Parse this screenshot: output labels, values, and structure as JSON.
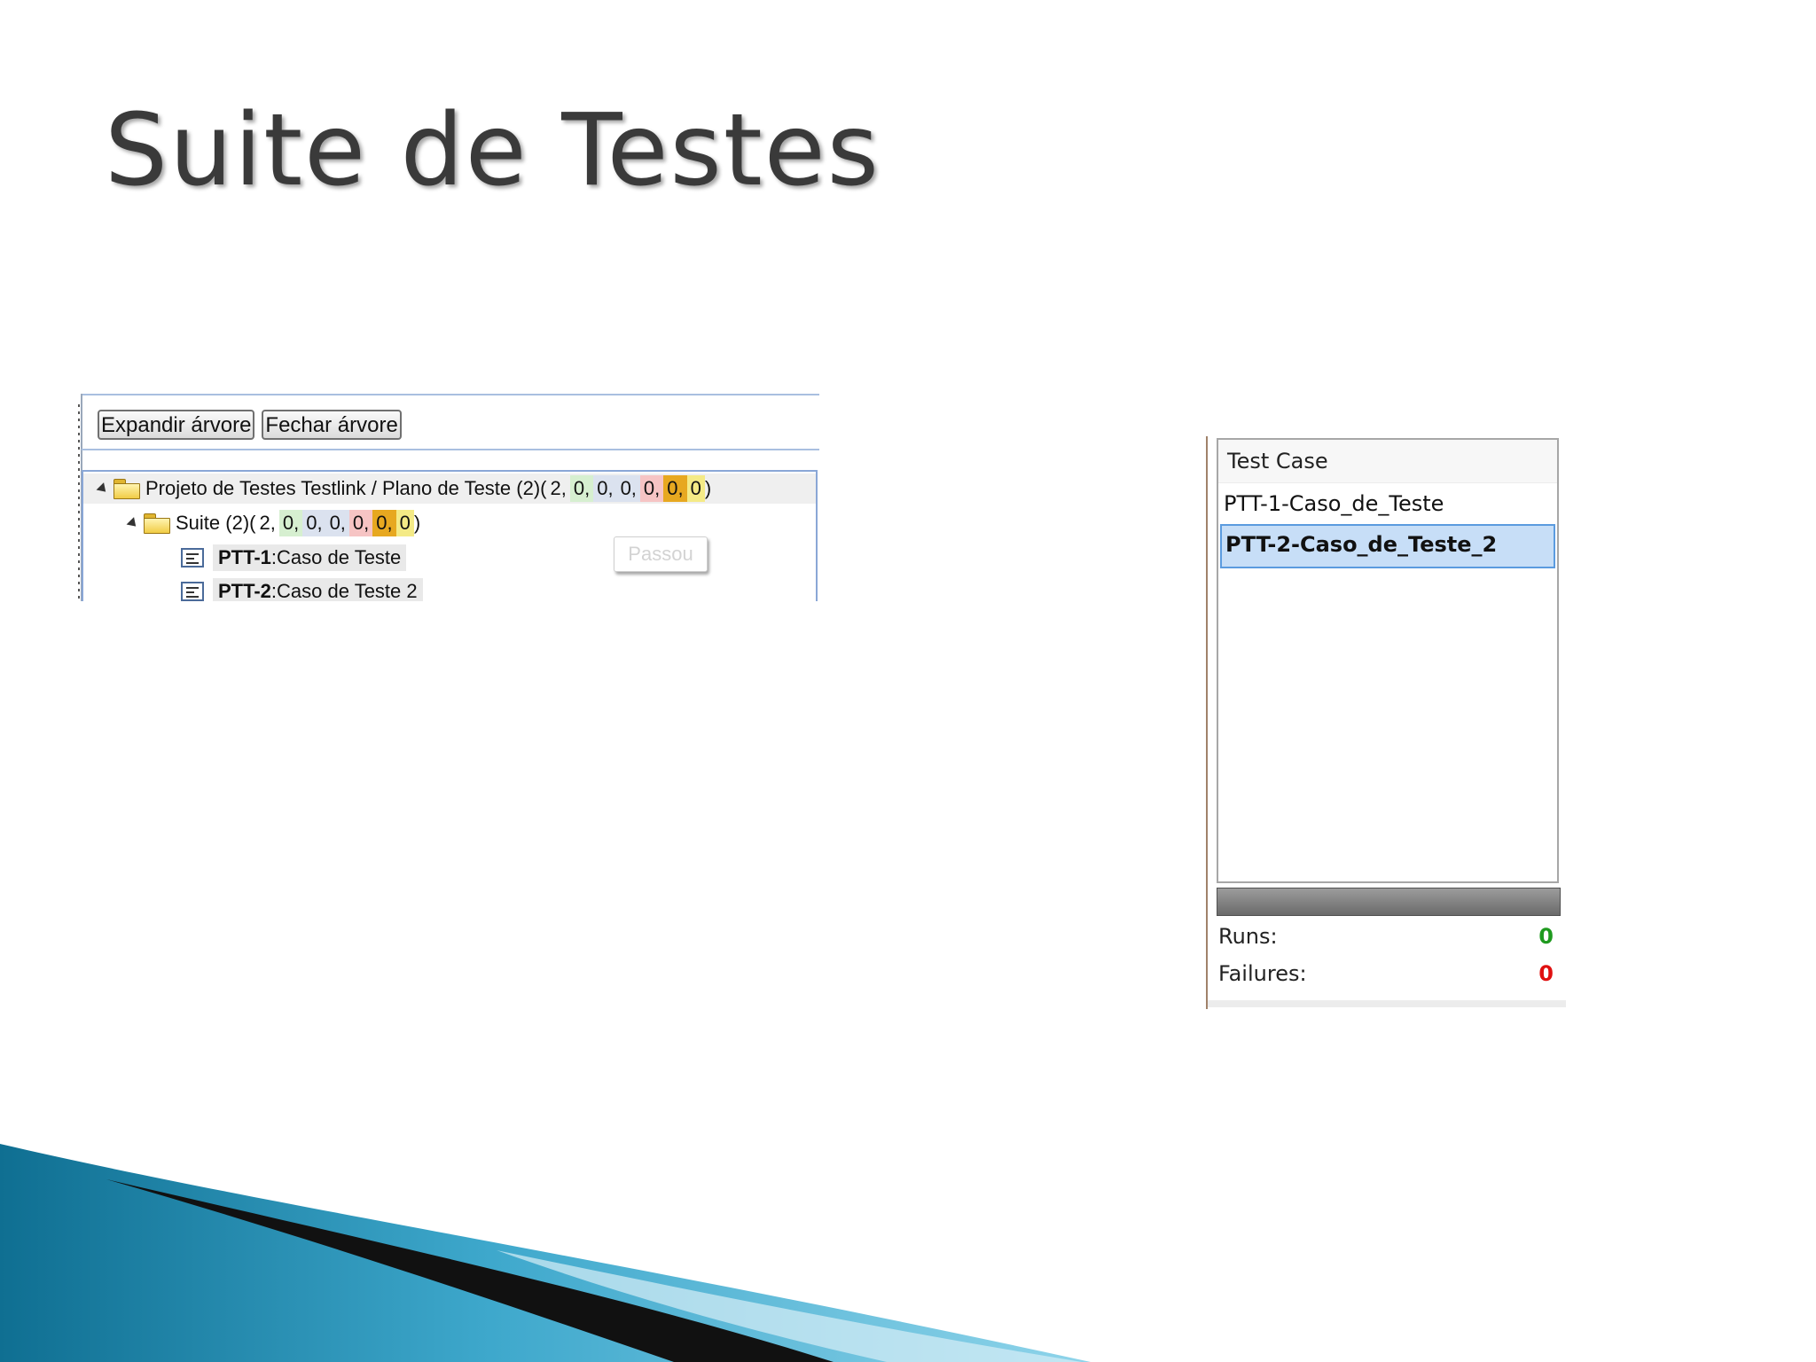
{
  "slide": {
    "title": "Suite de Testes"
  },
  "toolbar": {
    "expand_label": "Expandir árvore",
    "collapse_label": "Fechar árvore"
  },
  "tree": {
    "root": {
      "label": "Projeto de Testes Testlink / Plano de Teste (2)(",
      "counts": [
        "2,",
        "0,",
        "0,",
        "0,",
        "0,",
        "0,",
        "0"
      ],
      "close": ")"
    },
    "suite": {
      "label": "Suite (2)(",
      "counts": [
        "2,",
        "0,",
        "0,",
        "0,",
        "0,",
        "0,",
        "0"
      ],
      "close": ")"
    },
    "cases": [
      {
        "id": "PTT-1",
        "sep": ":",
        "name": "Caso de Teste"
      },
      {
        "id": "PTT-2",
        "sep": ":",
        "name": "Caso de Teste 2"
      }
    ],
    "tooltip": "Passou"
  },
  "runner": {
    "header": "Test Case",
    "cases": [
      "PTT-1-Caso_de_Teste",
      "PTT-2-Caso_de_Teste_2"
    ],
    "selected_index": 1,
    "stats": {
      "runs_label": "Runs:",
      "runs_value": "0",
      "failures_label": "Failures:",
      "failures_value": "0"
    }
  },
  "colors": {
    "runs_value": "#1f9a1f",
    "failures_value": "#e01010",
    "count_green": "#d6efd0",
    "count_blue": "#dbe2ef",
    "count_pink": "#f6c4c4",
    "count_gold": "#e7a820",
    "count_yellow": "#f4ea86"
  },
  "icons": {
    "folder": "folder-icon",
    "test_case": "test-case-icon",
    "expand": "triangle-expanded-icon"
  }
}
